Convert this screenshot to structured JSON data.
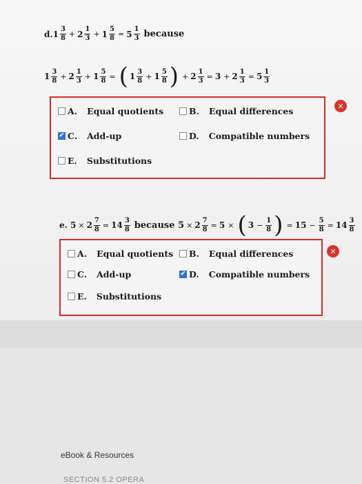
{
  "problem_d": {
    "label": "d.",
    "because": "because",
    "line1": [
      {
        "w": "1",
        "n": "3",
        "d": "8"
      },
      {
        "op": "+"
      },
      {
        "w": "2",
        "n": "1",
        "d": "3"
      },
      {
        "op": "+"
      },
      {
        "w": "1",
        "n": "5",
        "d": "8"
      },
      {
        "op": "="
      },
      {
        "w": "5",
        "n": "1",
        "d": "3"
      }
    ],
    "line2_parts": {
      "a": {
        "w": "1",
        "n": "3",
        "d": "8"
      },
      "b": {
        "w": "2",
        "n": "1",
        "d": "3"
      },
      "c": {
        "w": "1",
        "n": "5",
        "d": "8"
      },
      "p1": {
        "w": "1",
        "n": "3",
        "d": "8"
      },
      "p2": {
        "w": "1",
        "n": "5",
        "d": "8"
      },
      "q": {
        "w": "2",
        "n": "1",
        "d": "3"
      },
      "three": "3",
      "r": {
        "w": "2",
        "n": "1",
        "d": "3"
      },
      "s": {
        "w": "5",
        "n": "1",
        "d": "3"
      }
    },
    "options": [
      {
        "letter": "A.",
        "label": "Equal quotients",
        "checked": false
      },
      {
        "letter": "B.",
        "label": "Equal differences",
        "checked": false
      },
      {
        "letter": "C.",
        "label": "Add-up",
        "checked": true
      },
      {
        "letter": "D.",
        "label": "Compatible numbers",
        "checked": false
      },
      {
        "letter": "E.",
        "label": "Substitutions",
        "checked": false
      }
    ]
  },
  "problem_e": {
    "label": "e. 5",
    "times": "×",
    "because": "because 5",
    "mixed1": {
      "w": "2",
      "n": "7",
      "d": "8"
    },
    "res1": {
      "w": "14",
      "n": "3",
      "d": "8"
    },
    "mixed2": {
      "w": "2",
      "n": "7",
      "d": "8"
    },
    "five": "5",
    "three": "3",
    "frac_in": {
      "n": "1",
      "d": "8"
    },
    "fifteen": "15",
    "frac_sub": {
      "n": "5",
      "d": "8"
    },
    "res2": {
      "w": "14",
      "n": "3",
      "d": "8"
    },
    "options": [
      {
        "letter": "A.",
        "label": "Equal quotients",
        "checked": false
      },
      {
        "letter": "B.",
        "label": "Equal differences",
        "checked": false
      },
      {
        "letter": "C.",
        "label": "Add-up",
        "checked": false
      },
      {
        "letter": "D.",
        "label": "Compatible numbers",
        "checked": true
      },
      {
        "letter": "E.",
        "label": "Substitutions",
        "checked": false
      }
    ]
  },
  "icons": {
    "close": "x-icon",
    "check": "checkmark-icon"
  },
  "colors": {
    "accent_red": "#d22b2b",
    "check_blue": "#2f6fd8",
    "close_red": "#d9342b"
  },
  "footer": {
    "ebook": "eBook & Resources",
    "section": "SECTION 5.2 OPERA"
  }
}
